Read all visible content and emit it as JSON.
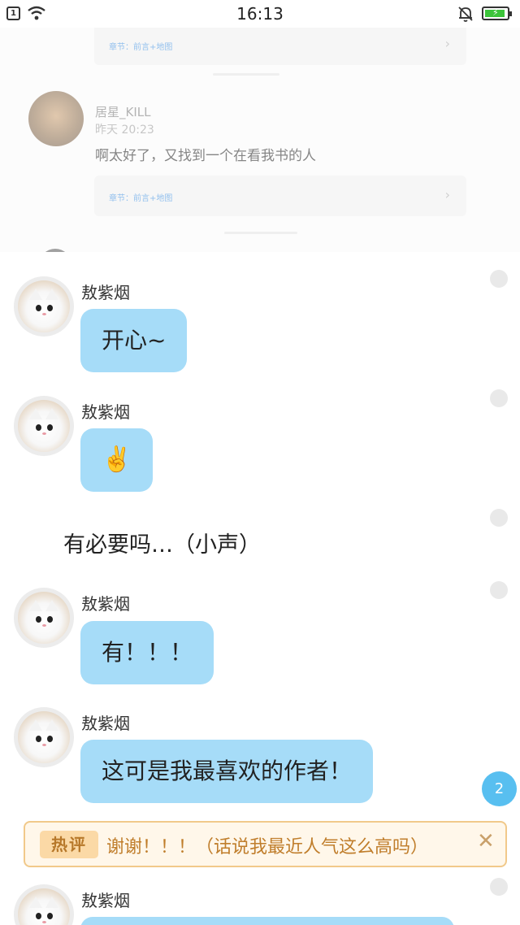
{
  "status_bar": {
    "time": "16:13",
    "sim_label": "1"
  },
  "background_comments": {
    "chapter_link_text": "章节：前言+地图",
    "chapter_arrow": "›",
    "comment": {
      "username": "居星_KILL",
      "time": "昨天 20:23",
      "text": "啊太好了，又找到一个在看我书的人"
    }
  },
  "chat": {
    "messages": [
      {
        "type": "bubble",
        "sender": "敖紫烟",
        "text": "开心~"
      },
      {
        "type": "bubble",
        "sender": "敖紫烟",
        "text": "✌️"
      },
      {
        "type": "narration",
        "text": "有必要吗…（小声）"
      },
      {
        "type": "bubble",
        "sender": "敖紫烟",
        "text": "有！！！"
      },
      {
        "type": "bubble",
        "sender": "敖紫烟",
        "text": "这可是我最喜欢的作者！"
      },
      {
        "type": "bubble",
        "sender": "敖紫烟",
        "text": ""
      }
    ]
  },
  "comment_count_badge": "2",
  "hot_comment": {
    "tag": "热评",
    "text": "谢谢！！！（话说我最近人气这么高吗）",
    "close_icon": "close-icon"
  },
  "colors": {
    "bubble": "#a6dcf8",
    "badge": "#58bff0",
    "hot_border": "#f1c98a",
    "hot_text": "#c07e2c"
  }
}
